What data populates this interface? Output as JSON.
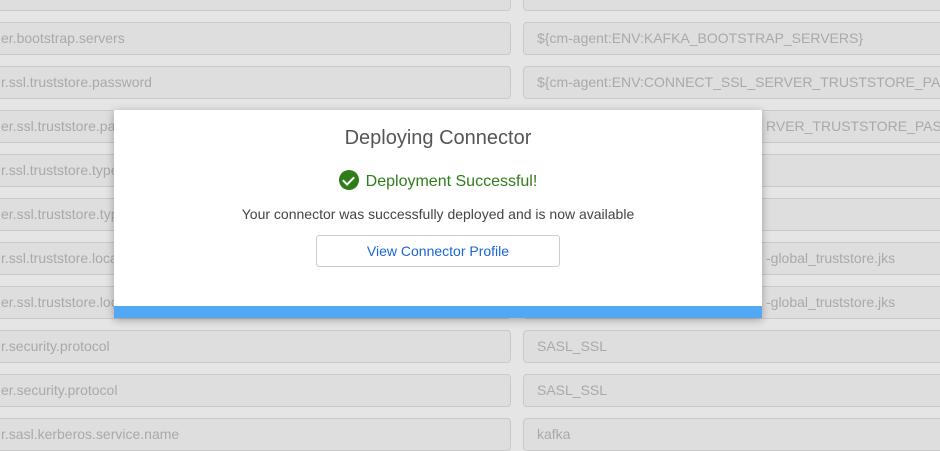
{
  "rows": [
    {
      "key": "",
      "value": ""
    },
    {
      "key": "er.bootstrap.servers",
      "value": "${cm-agent:ENV:KAFKA_BOOTSTRAP_SERVERS}"
    },
    {
      "key": "r.ssl.truststore.password",
      "value": "${cm-agent:ENV:CONNECT_SSL_SERVER_TRUSTSTORE_PASSWO"
    },
    {
      "key": "er.ssl.truststore.pa",
      "value": "RVER_TRUSTSTORE_PASSWO"
    },
    {
      "key": "r.ssl.truststore.type",
      "value": ""
    },
    {
      "key": "er.ssl.truststore.typ",
      "value": ""
    },
    {
      "key": "r.ssl.truststore.loca",
      "value": "-global_truststore.jks"
    },
    {
      "key": "er.ssl.truststore.loc",
      "value": "-global_truststore.jks"
    },
    {
      "key": "r.security.protocol",
      "value": "SASL_SSL"
    },
    {
      "key": "er.security.protocol",
      "value": "SASL_SSL"
    },
    {
      "key": "r.sasl.kerberos.service.name",
      "value": "kafka"
    }
  ],
  "modal": {
    "title": "Deploying Connector",
    "status": "Deployment Successful!",
    "message": "Your connector was successfully deployed and is now available",
    "button": "View Connector Profile",
    "progress_percent": 100,
    "colors": {
      "success": "#2e7d19",
      "progress": "#52a8f4",
      "link": "#1a66d9"
    }
  }
}
